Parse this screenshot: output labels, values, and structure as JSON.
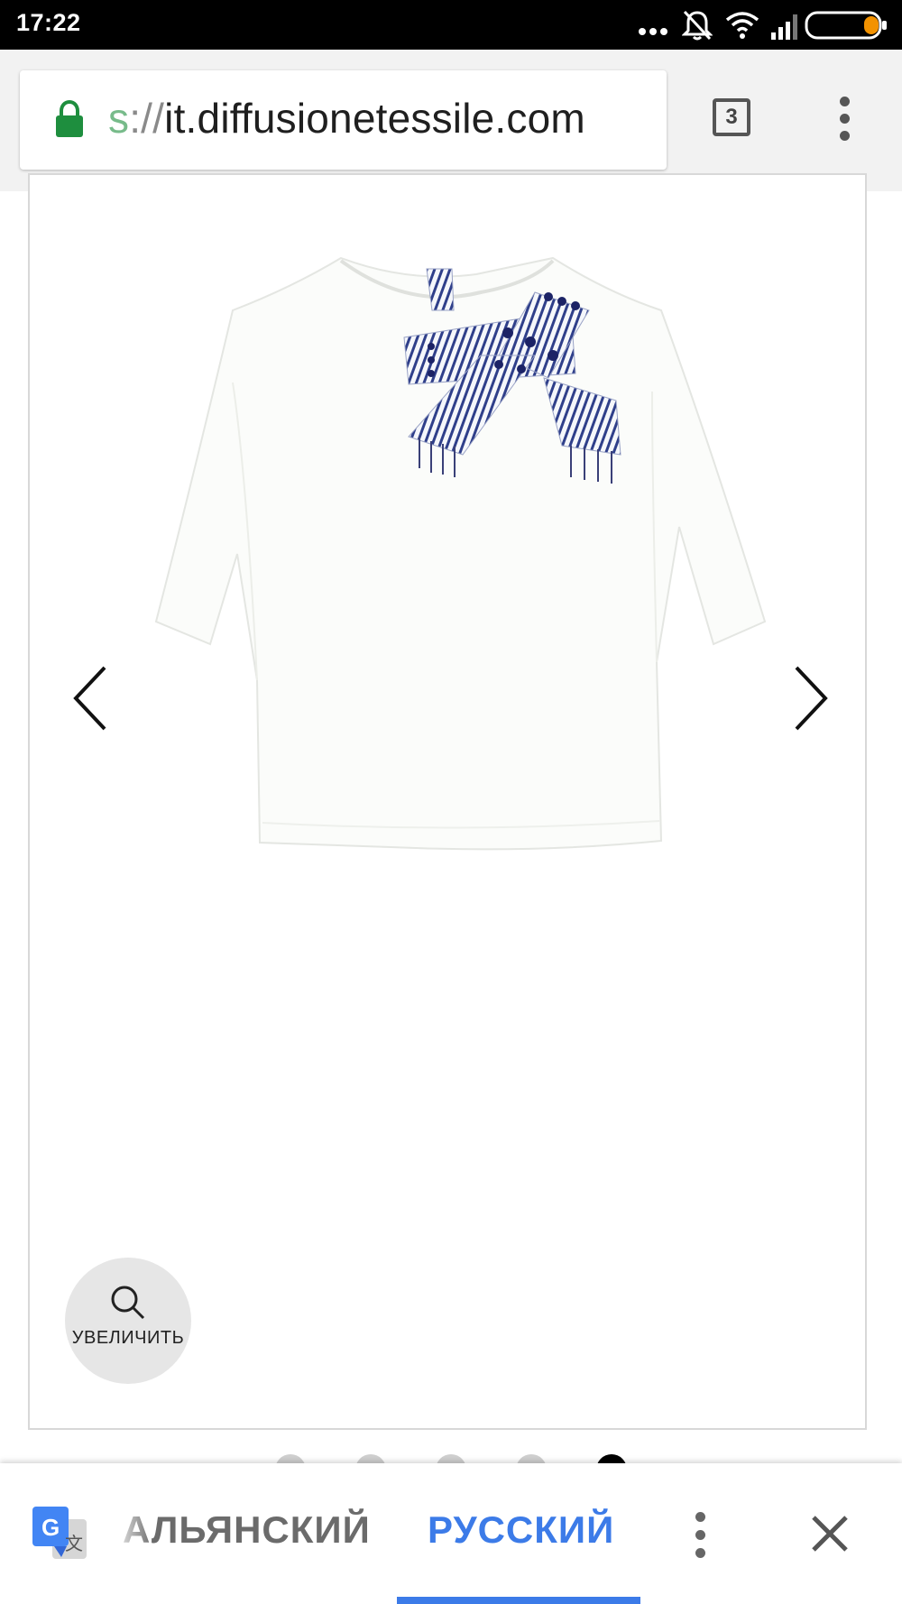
{
  "status_bar": {
    "time": "17:22",
    "icons": [
      "more-dots-icon",
      "bell-off-icon",
      "wifi-icon",
      "signal-icon",
      "battery-icon"
    ],
    "battery_color": "#f39200"
  },
  "browser": {
    "url_scheme": "s",
    "url_separator": "://",
    "url_host": "it.diffusionetessile.com",
    "tab_count": "3",
    "secure_color": "#1e8e3e"
  },
  "product": {
    "image_desc": "product-photo",
    "zoom_label": "УВЕЛИЧИТЬ",
    "slides_total": 5,
    "slide_active": 5
  },
  "translate_bar": {
    "source_language": "АЛЬЯНСКИЙ",
    "target_language": "РУССКИЙ",
    "accent_color": "#3c7be8"
  }
}
